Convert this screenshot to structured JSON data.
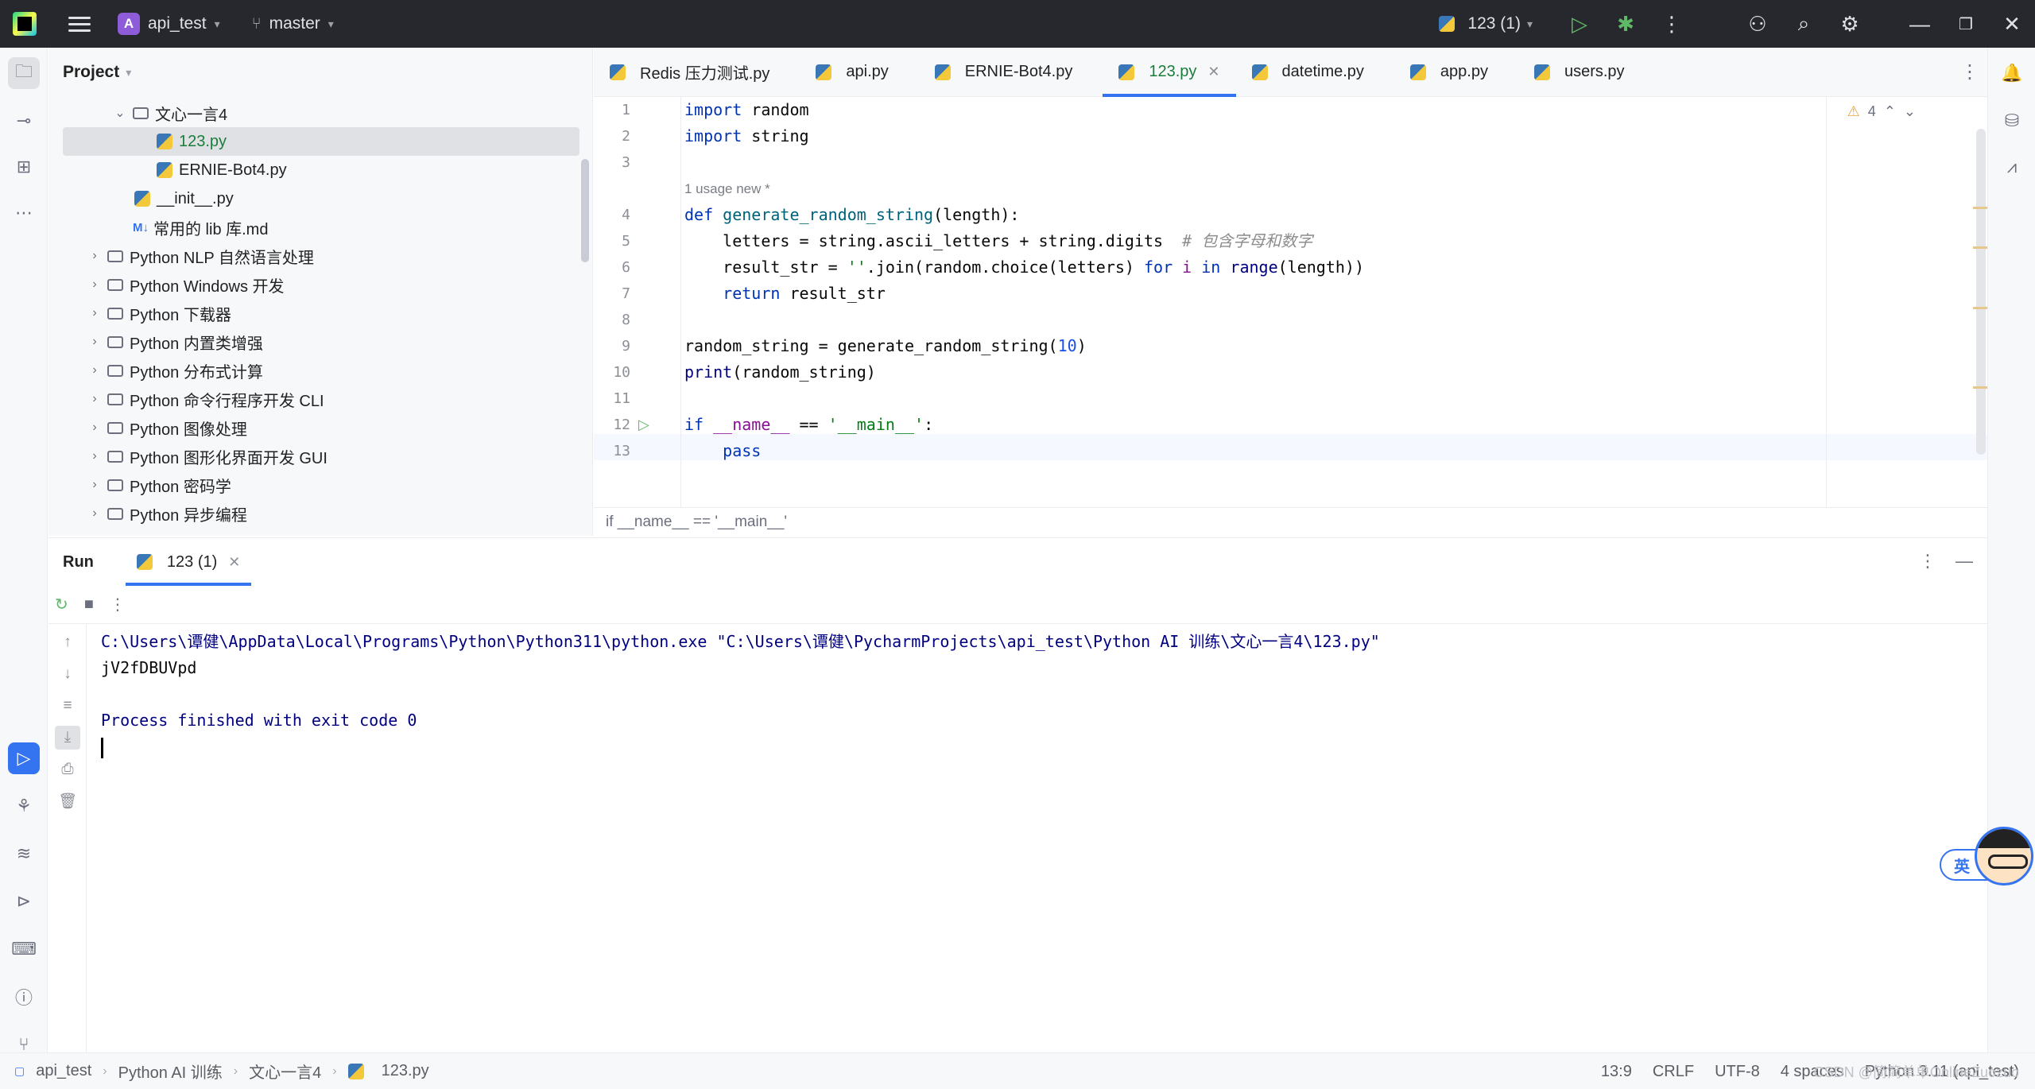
{
  "titlebar": {
    "project_initial": "A",
    "project_name": "api_test",
    "branch": "master",
    "run_config": "123 (1)"
  },
  "project_panel": {
    "title": "Project",
    "items": [
      {
        "label": "文心一言4",
        "type": "folder",
        "expanded": true
      },
      {
        "label": "123.py",
        "type": "python",
        "selected": true
      },
      {
        "label": "ERNIE-Bot4.py",
        "type": "python"
      },
      {
        "label": "__init__.py",
        "type": "python"
      },
      {
        "label": "常用的 lib 库.md",
        "type": "markdown",
        "icon_text": "M↓"
      },
      {
        "label": "Python NLP 自然语言处理",
        "type": "folder"
      },
      {
        "label": "Python Windows 开发",
        "type": "folder"
      },
      {
        "label": "Python 下载器",
        "type": "folder"
      },
      {
        "label": "Python 内置类增强",
        "type": "folder"
      },
      {
        "label": "Python 分布式计算",
        "type": "folder"
      },
      {
        "label": "Python 命令行程序开发 CLI",
        "type": "folder"
      },
      {
        "label": "Python 图像处理",
        "type": "folder"
      },
      {
        "label": "Python 图形化界面开发  GUI",
        "type": "folder"
      },
      {
        "label": "Python 密码学",
        "type": "folder"
      },
      {
        "label": "Python 异步编程",
        "type": "folder"
      }
    ]
  },
  "tabs": [
    {
      "label": "Redis 压力测试.py",
      "active": false
    },
    {
      "label": "api.py",
      "active": false
    },
    {
      "label": "ERNIE-Bot4.py",
      "active": false
    },
    {
      "label": "123.py",
      "active": true
    },
    {
      "label": "datetime.py",
      "active": false
    },
    {
      "label": "app.py",
      "active": false
    },
    {
      "label": "users.py",
      "active": false
    }
  ],
  "editor": {
    "warning_count": "4",
    "inlay_hint": "1 usage   new *",
    "line_numbers": [
      "1",
      "2",
      "3",
      "4",
      "5",
      "6",
      "7",
      "8",
      "9",
      "10",
      "11",
      "12",
      "13"
    ],
    "breadcrumb": "if __name__ == '__main__'"
  },
  "run_panel": {
    "title": "Run",
    "tab_label": "123 (1)",
    "console": {
      "command": "C:\\Users\\谭健\\AppData\\Local\\Programs\\Python\\Python311\\python.exe \"C:\\Users\\谭健\\PycharmProjects\\api_test\\Python AI 训练\\文心一言4\\123.py\"",
      "output": "jV2fDBUVpd",
      "exit_message": "Process finished with exit code 0"
    }
  },
  "ime": {
    "label": "英"
  },
  "statusbar": {
    "crumbs": [
      "api_test",
      "Python AI 训练",
      "文心一言4",
      "123.py"
    ],
    "position": "13:9",
    "line_sep": "CRLF",
    "encoding": "UTF-8",
    "indent": "4 spaces",
    "interpreter": "Python 3.11 (api_test)",
    "watermark": "CSDN @简简单单OnlineZuozuo"
  },
  "colors": {
    "accent": "#3574f0",
    "titlebar_bg": "#27282e",
    "run_green": "#5fb865",
    "active_tab_text": "#1a7e3b"
  }
}
